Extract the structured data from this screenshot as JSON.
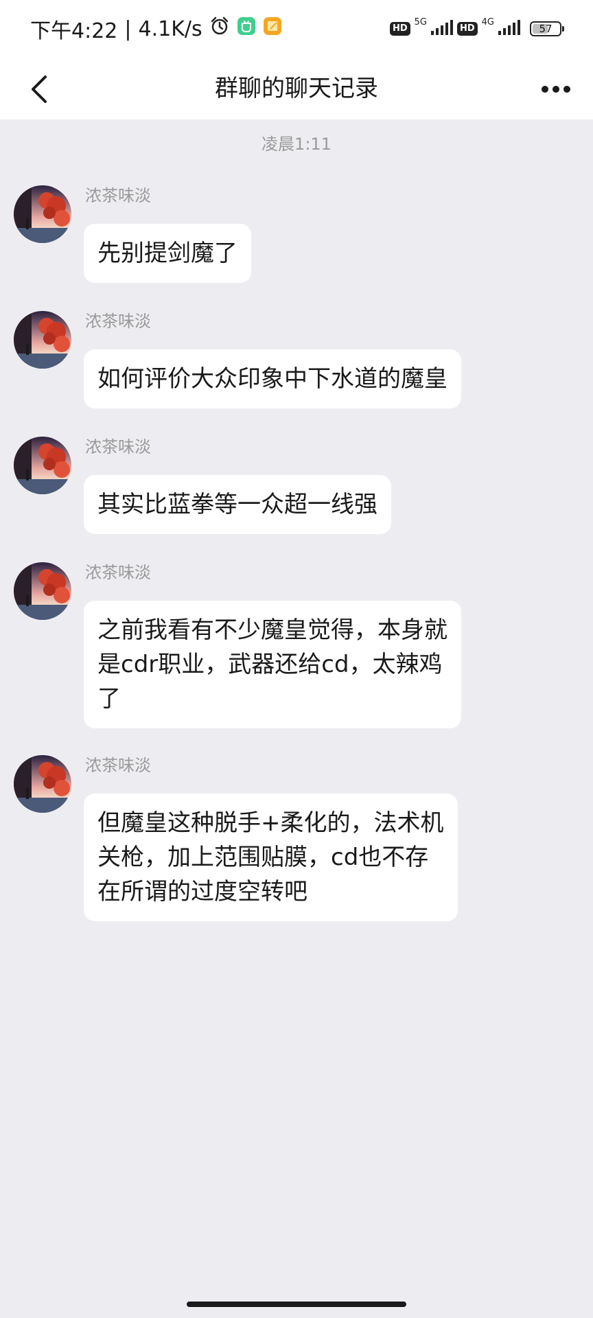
{
  "status_bar": {
    "time": "下午4:22",
    "separator": "|",
    "net_speed": "4.1K/s",
    "hd_label": "HD",
    "net_5g": "5G",
    "net_4g": "4G",
    "battery": "57",
    "battery_fraction": 0.57
  },
  "nav": {
    "title": "群聊的聊天记录",
    "back_icon": "chevron-left-icon",
    "more_icon": "more-horizontal-icon"
  },
  "chat": {
    "timestamp": "凌晨1:11",
    "messages": [
      {
        "sender": "浓茶味淡",
        "text": "先别提剑魔了"
      },
      {
        "sender": "浓茶味淡",
        "text": "如何评价大众印象中下水道的魔皇"
      },
      {
        "sender": "浓茶味淡",
        "text": "其实比蓝拳等一众超一线强"
      },
      {
        "sender": "浓茶味淡",
        "text": "之前我看有不少魔皇觉得，本身就\n是cdr职业，武器还给cd，太辣鸡\n了"
      },
      {
        "sender": "浓茶味淡",
        "text": "但魔皇这种脱手+柔化的，法术机\n关枪，加上范围贴膜，cd也不存\n在所谓的过度空转吧"
      }
    ]
  },
  "colors": {
    "background": "#ededf1",
    "bubble": "#ffffff",
    "header": "#ffffff",
    "muted_text": "#9a9a9a"
  }
}
